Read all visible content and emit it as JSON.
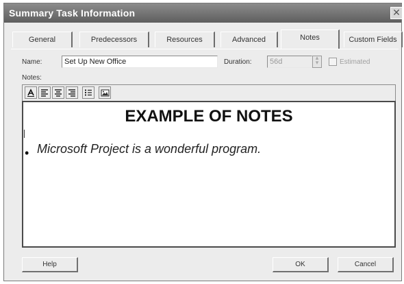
{
  "window": {
    "title": "Summary Task Information"
  },
  "tabs": [
    {
      "label": "General"
    },
    {
      "label": "Predecessors"
    },
    {
      "label": "Resources"
    },
    {
      "label": "Advanced"
    },
    {
      "label": "Notes",
      "active": true
    },
    {
      "label": "Custom Fields"
    }
  ],
  "fields": {
    "name_label": "Name:",
    "name_value": "Set Up New Office",
    "duration_label": "Duration:",
    "duration_value": "56d",
    "estimated_label": "Estimated",
    "estimated_checked": false
  },
  "notes": {
    "label": "Notes:",
    "heading": "EXAMPLE OF NOTES",
    "bullet_text": "Microsoft Project is a wonderful program."
  },
  "toolbar_icons": [
    "font-icon",
    "align-left-icon",
    "align-center-icon",
    "align-right-icon",
    "bullets-icon",
    "insert-object-icon"
  ],
  "buttons": {
    "help": "Help",
    "ok": "OK",
    "cancel": "Cancel"
  }
}
